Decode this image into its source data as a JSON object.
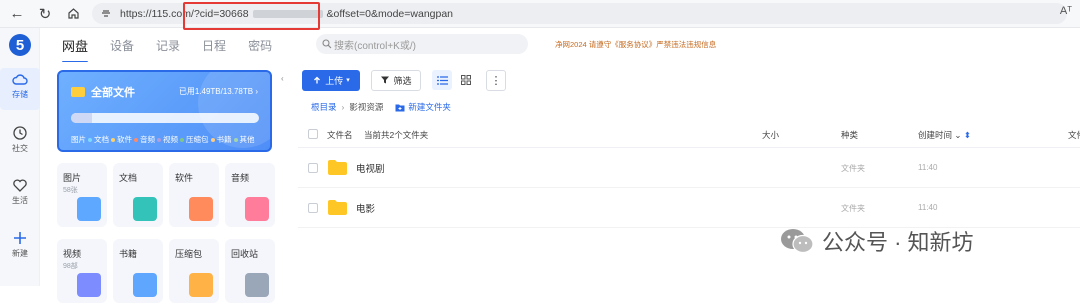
{
  "browser": {
    "url_prefix": "https://115.com/",
    "url_cid": "?cid=30668",
    "url_suffix": "&offset=0&mode=wangpan",
    "reader_label": "Aᵀ"
  },
  "nav": {
    "tabs": [
      "网盘",
      "设备",
      "记录",
      "日程",
      "密码"
    ],
    "search_placeholder": "搜索(control+K或/)",
    "notice": "净网2024 请遵守《服务协议》严禁违法违规信息"
  },
  "rail": {
    "items": [
      {
        "label": "存储",
        "icon": "cloud-icon"
      },
      {
        "label": "社交",
        "icon": "clock-icon"
      },
      {
        "label": "生活",
        "icon": "heart-icon"
      },
      {
        "label": "新建",
        "icon": "plus-icon"
      }
    ]
  },
  "storage": {
    "title": "全部文件",
    "usage_text": "已用1.49TB/13.78TB",
    "usage_fraction": 0.11,
    "legend": [
      "图片",
      "文档",
      "软件",
      "音频",
      "视频",
      "压缩包",
      "书籍",
      "其他"
    ],
    "legend_colors": [
      "#ffffff",
      "#7cd9ff",
      "#ffd166",
      "#ff8a65",
      "#b39ddb",
      "#81c784",
      "#ffcc80",
      "#a5d6a7"
    ]
  },
  "categories": [
    {
      "label": "图片",
      "count": "58张",
      "color": "#5ea8ff"
    },
    {
      "label": "文档",
      "count": "",
      "color": "#34c3b8"
    },
    {
      "label": "软件",
      "count": "",
      "color": "#ff8a5c"
    },
    {
      "label": "音频",
      "count": "",
      "color": "#ff7c9b"
    },
    {
      "label": "视频",
      "count": "98部",
      "color": "#7d8cff"
    },
    {
      "label": "书籍",
      "count": "",
      "color": "#5fa6ff"
    },
    {
      "label": "压缩包",
      "count": "",
      "color": "#ffb347"
    },
    {
      "label": "回收站",
      "count": "",
      "color": "#9aa7b8"
    }
  ],
  "toolbar": {
    "upload": "上传",
    "filter": "筛选"
  },
  "breadcrumb": {
    "root": "根目录",
    "current": "影视资源",
    "new_folder": "新建文件夹"
  },
  "table": {
    "header_name": "文件名",
    "header_summary": "当前共2个文件夹",
    "header_size": "大小",
    "header_type": "种类",
    "header_time": "创建时间",
    "header_extra": "文件",
    "rows": [
      {
        "name": "电视剧",
        "type": "文件夹",
        "time": "11:40"
      },
      {
        "name": "电影",
        "type": "文件夹",
        "time": "11:40"
      }
    ]
  },
  "watermark": "公众号 · 知新坊"
}
